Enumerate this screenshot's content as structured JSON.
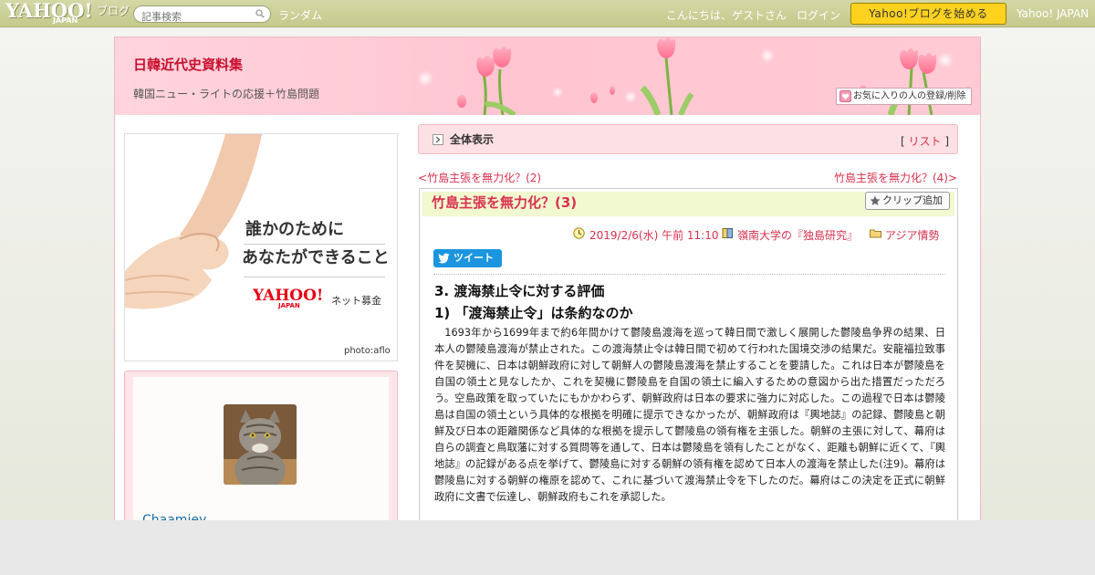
{
  "topbar": {
    "logo_yahoo": "YAHOO!",
    "logo_japan": "JAPAN",
    "logo_blog": "ブログ",
    "search_placeholder": "記事検索",
    "random_label": "ランダム",
    "greeting": "こんにちは、ゲストさん",
    "login_label": "ログイン",
    "start_blog_label": "Yahoo!ブログを始める",
    "yahoo_japan_label": "Yahoo! JAPAN"
  },
  "header": {
    "blog_title": "日韓近代史資料集",
    "blog_subtitle": "韓国ニュー・ライトの応援＋竹島問題",
    "favorite_label": "お気に入りの人の登録/削除"
  },
  "sidebar": {
    "ad": {
      "line1": "誰かのために",
      "line2": "あなたができること",
      "logo_yahoo": "YAHOO!",
      "logo_japan": "JAPAN",
      "service": "ネット募金",
      "credit": "photo:aflo"
    },
    "profile": {
      "name": "Chaamiey"
    }
  },
  "main": {
    "list_bar": {
      "label": "全体表示",
      "list_open": "[ ",
      "list_link": "リスト",
      "list_close": " ]"
    },
    "nav": {
      "prev_arrow": "<",
      "prev_label": "竹島主張を無力化？(2)",
      "next_label": "竹島主張を無力化？(4)",
      "next_arrow": ">"
    },
    "article": {
      "title": "竹島主張を無力化？(3)",
      "clip_label": "クリップ追加",
      "date": "2019/2/6(水) 午前 11:10",
      "theme": "嶺南大学の『独島研究』",
      "category": "アジア情勢",
      "tweet_label": "ツイート",
      "section_heading": "3. 渡海禁止令に対する評価",
      "sub_heading": "1) 「渡海禁止令」は条約なのか",
      "body": "1693年から1699年まで約6年間かけて鬱陵島渡海を巡って韓日間で激しく展開した鬱陵島争界の結果、日本人の鬱陵島渡海が禁止された。この渡海禁止令は韓日間で初めて行われた国境交渉の結果だ。安龍福拉致事件を契機に、日本は朝鮮政府に対して朝鮮人の鬱陵島渡海を禁止することを要請した。これは日本が鬱陵島を自国の領土と見なしたか、これを契機に鬱陵島を自国の領土に編入するための意図から出た措置だっただろう。空島政策を取っていたにもかかわらず、朝鮮政府は日本の要求に強力に対応した。この過程で日本は鬱陵島は自国の領土という具体的な根拠を明確に提示できなかったが、朝鮮政府は『輿地誌』の記録、鬱陵島と朝鮮及び日本の距離関係など具体的な根拠を提示して鬱陵島の領有権を主張した。朝鮮の主張に対して、幕府は自らの調査と鳥取藩に対する質問等を通して、日本は鬱陵島を領有したことがなく、距離も朝鮮に近くて、『輿地誌』の記録がある点を挙げて、鬱陵島に対する朝鮮の領有権を認めて日本人の渡海を禁止した(注9)。幕府は鬱陵島に対する朝鮮の権原を認めて、これに基づいて渡海禁止令を下したのだ。幕府はこの決定を正式に朝鮮政府に文書で伝達し、朝鮮政府もこれを承認した。"
    }
  },
  "colors": {
    "accent_pink": "#d8324e",
    "topbar": "#c9cd94",
    "start_button": "#ffd21f",
    "tweet_blue": "#1b95e0"
  }
}
